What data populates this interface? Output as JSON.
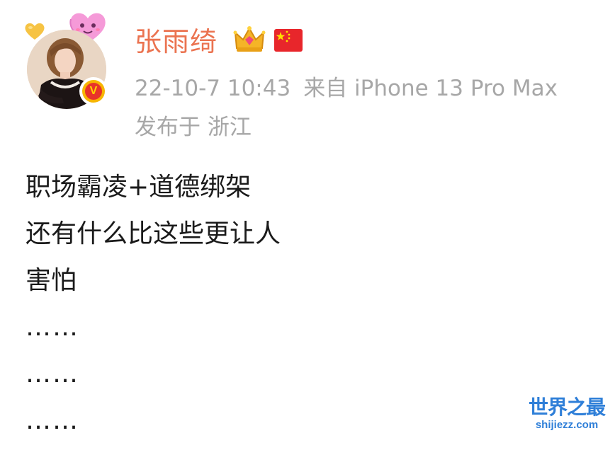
{
  "profile": {
    "username": "张雨绮",
    "avatar_alt": "avatar",
    "verified_mark": "V"
  },
  "meta": {
    "datetime": "22-10-7 10:43",
    "source": "来自 iPhone 13 Pro Max",
    "location": "发布于 浙江"
  },
  "post": {
    "lines": [
      "职场霸凌+道德绑架",
      "还有什么比这些更让人",
      "害怕",
      "……",
      "……",
      "……"
    ]
  },
  "watermark": {
    "title": "世界之最",
    "url": "shijiezz.com"
  },
  "colors": {
    "username": "#eb7350",
    "meta_text": "#a7a7a7",
    "body_text": "#1a1a1a",
    "watermark": "#2f7fd8",
    "verified_outer": "#f7b500",
    "verified_inner": "#e8332a"
  },
  "icons": {
    "crown": "crown-icon",
    "flag": "china-flag-icon",
    "heart_big": "pink-heart-icon",
    "heart_small": "yellow-heart-icon"
  }
}
